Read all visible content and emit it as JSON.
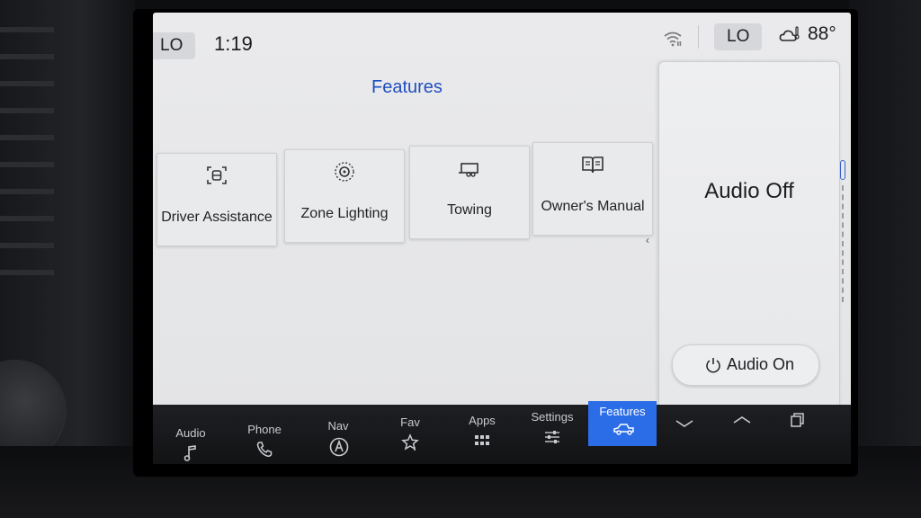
{
  "status_bar": {
    "left_climate": "LO",
    "time": "1:19",
    "right_climate": "LO",
    "temperature": "88°",
    "icons": [
      "wifi-icon",
      "weather-icon"
    ]
  },
  "page": {
    "title": "Features"
  },
  "tiles": [
    {
      "label": "Driver Assistance",
      "icon": "driver-assist-icon"
    },
    {
      "label": "Zone Lighting",
      "icon": "zone-lighting-icon"
    },
    {
      "label": "Towing",
      "icon": "towing-icon"
    },
    {
      "label": "Owner's Manual",
      "icon": "book-icon"
    }
  ],
  "audio_panel": {
    "status": "Audio Off",
    "button_label": "Audio On"
  },
  "nav": {
    "items": [
      {
        "label": "Audio",
        "icon": "music-note-icon"
      },
      {
        "label": "Phone",
        "icon": "phone-icon"
      },
      {
        "label": "Nav",
        "icon": "navigation-icon"
      },
      {
        "label": "Fav",
        "icon": "star-icon"
      },
      {
        "label": "Apps",
        "icon": "apps-grid-icon"
      },
      {
        "label": "Settings",
        "icon": "sliders-icon"
      },
      {
        "label": "Features",
        "icon": "truck-icon",
        "active": true
      }
    ],
    "active_color": "#2b6de6"
  },
  "colors": {
    "title_blue": "#1f4fbf",
    "screen_bg": "#e6e7e9"
  }
}
